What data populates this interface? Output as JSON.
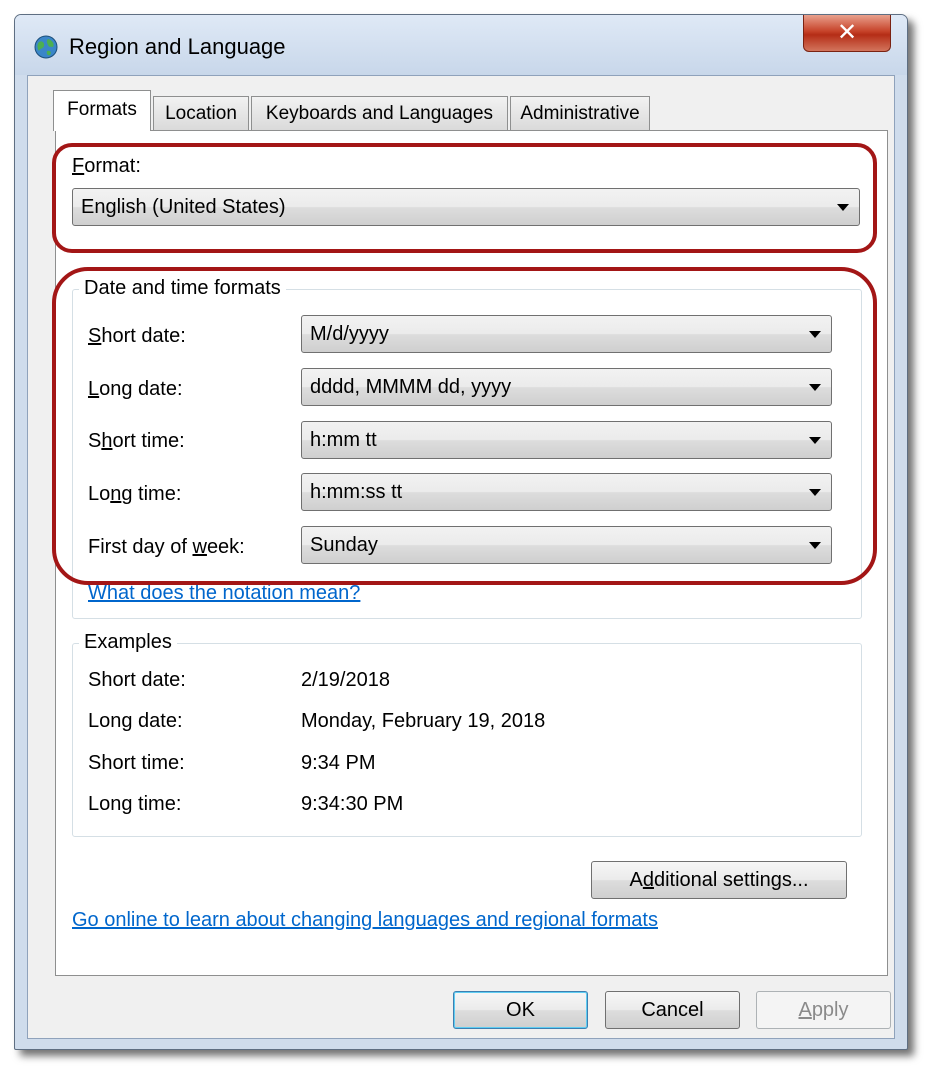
{
  "window": {
    "title": "Region and Language",
    "close_glyph": "✕"
  },
  "tabs": [
    {
      "label": "Formats",
      "active": true
    },
    {
      "label": "Location",
      "active": false
    },
    {
      "label": "Keyboards and Languages",
      "active": false
    },
    {
      "label": "Administrative",
      "active": false
    }
  ],
  "format": {
    "label_mn": "F",
    "label_rest": "ormat:",
    "value": "English (United States)"
  },
  "date_time": {
    "title": "Date and time formats",
    "rows": [
      {
        "pre": "",
        "mn": "S",
        "post": "hort date:",
        "value": "M/d/yyyy"
      },
      {
        "pre": "",
        "mn": "L",
        "post": "ong date:",
        "value": "dddd, MMMM dd, yyyy"
      },
      {
        "pre": "S",
        "mn": "h",
        "post": "ort time:",
        "value": "h:mm tt"
      },
      {
        "pre": "Lo",
        "mn": "n",
        "post": "g time:",
        "value": "h:mm:ss tt"
      },
      {
        "pre": "First day of ",
        "mn": "w",
        "post": "eek:",
        "value": "Sunday"
      }
    ],
    "link": "What does the notation mean?"
  },
  "examples": {
    "title": "Examples",
    "rows": [
      {
        "label": "Short date:",
        "value": "2/19/2018"
      },
      {
        "label": "Long date:",
        "value": "Monday, February 19, 2018"
      },
      {
        "label": "Short time:",
        "value": "9:34 PM"
      },
      {
        "label": "Long time:",
        "value": "9:34:30 PM"
      }
    ]
  },
  "additional_settings": {
    "pre": "A",
    "mn": "d",
    "post": "ditional settings..."
  },
  "online_link": "Go online to learn about changing languages and regional formats",
  "footer": {
    "ok": "OK",
    "cancel": "Cancel",
    "apply_mn": "A",
    "apply_rest": "pply"
  },
  "colors": {
    "highlight": "#a31616",
    "link": "#0066cc",
    "accent": "#3c7fb1"
  },
  "icons": {
    "app": "globe-icon",
    "dropdown": "chevron-down-icon"
  }
}
